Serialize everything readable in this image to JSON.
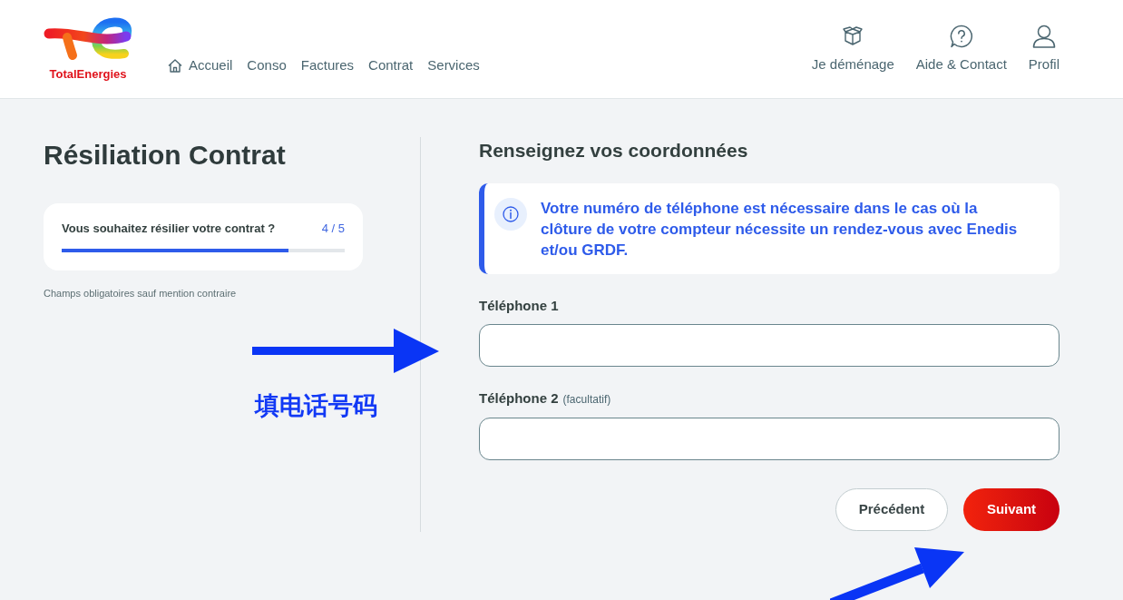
{
  "header": {
    "logo": {
      "wordmark": "TotalEnergies"
    },
    "home": {
      "label": "Accueil"
    },
    "nav": [
      {
        "label": "Conso"
      },
      {
        "label": "Factures"
      },
      {
        "label": "Contrat"
      },
      {
        "label": "Services"
      }
    ],
    "actions": [
      {
        "label": "Je déménage"
      },
      {
        "label": "Aide & Contact"
      },
      {
        "label": "Profil"
      }
    ]
  },
  "sidebar": {
    "title": "Résiliation Contrat",
    "progress": {
      "label": "Vous souhaitez résilier votre contrat ?",
      "step": "4 / 5",
      "level": 0.8
    },
    "note": "Champs obligatoires sauf mention contraire"
  },
  "form": {
    "heading": "Renseignez vos coordonnées",
    "info": "Votre numéro de téléphone est nécessaire dans le cas où la clôture de votre compteur nécessite un rendez-vous avec Enedis et/ou GRDF.",
    "fields": [
      {
        "label": "Téléphone 1"
      },
      {
        "label": "Téléphone 2",
        "hint": "(facultatif)"
      }
    ],
    "buttons": [
      {
        "label": "Précédent",
        "kind": "secondary"
      },
      {
        "label": "Suivant",
        "kind": "primary"
      }
    ]
  },
  "annotation": {
    "text": "填电话号码"
  }
}
